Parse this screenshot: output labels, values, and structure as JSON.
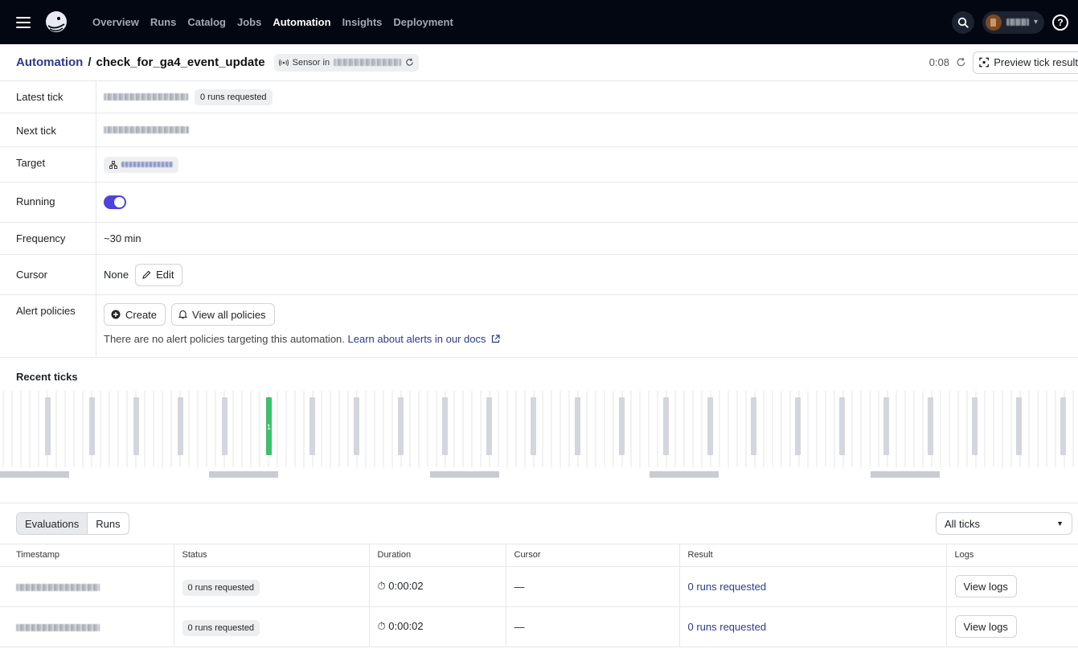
{
  "nav": {
    "items": [
      {
        "label": "Overview",
        "active": false
      },
      {
        "label": "Runs",
        "active": false
      },
      {
        "label": "Catalog",
        "active": false
      },
      {
        "label": "Jobs",
        "active": false
      },
      {
        "label": "Automation",
        "active": true
      },
      {
        "label": "Insights",
        "active": false
      },
      {
        "label": "Deployment",
        "active": false
      }
    ],
    "help": "?"
  },
  "header": {
    "breadcrumb_root": "Automation",
    "separator": "/",
    "title": "check_for_ga4_event_update",
    "sensor_label": "Sensor in",
    "timer": "0:08",
    "preview_button": "Preview tick result"
  },
  "details": {
    "latest_tick_label": "Latest tick",
    "latest_tick_badge": "0 runs requested",
    "next_tick_label": "Next tick",
    "target_label": "Target",
    "running_label": "Running",
    "running": true,
    "frequency_label": "Frequency",
    "frequency_value": "~30 min",
    "cursor_label": "Cursor",
    "cursor_value": "None",
    "edit_button": "Edit",
    "alert_policies_label": "Alert policies",
    "create_button": "Create",
    "view_all_button": "View all policies",
    "alert_note": "There are no alert policies targeting this automation.",
    "alert_link": "Learn about alerts in our docs"
  },
  "recent_ticks": {
    "title": "Recent ticks",
    "highlight_label": "1"
  },
  "tabs": {
    "evaluations": "Evaluations",
    "runs": "Runs",
    "filter": "All ticks"
  },
  "table": {
    "columns": [
      "Timestamp",
      "Status",
      "Duration",
      "Cursor",
      "Result",
      "Logs"
    ],
    "rows": [
      {
        "status": "0 runs requested",
        "duration": "0:00:02",
        "cursor": "—",
        "result": "0 runs requested",
        "logs": "View logs"
      },
      {
        "status": "0 runs requested",
        "duration": "0:00:02",
        "cursor": "—",
        "result": "0 runs requested",
        "logs": "View logs"
      }
    ]
  },
  "colors": {
    "nav_bg": "#030712",
    "accent": "#4f43dd",
    "link": "#2d3a8c",
    "tick_success": "#3fbf6b",
    "tick_skipped": "#d3d6dc"
  }
}
